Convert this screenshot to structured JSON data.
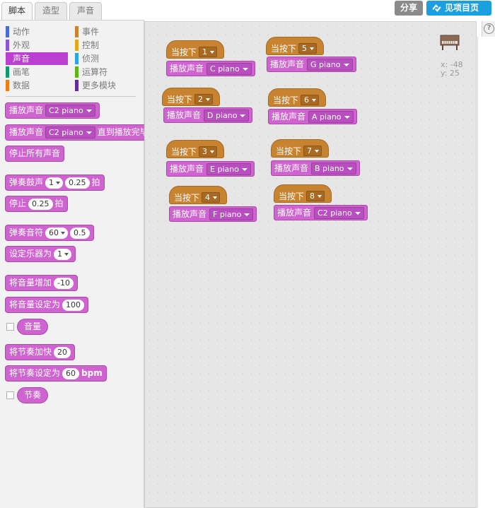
{
  "tabs": [
    {
      "label": "脚本",
      "active": true
    },
    {
      "label": "造型",
      "active": false
    },
    {
      "label": "声音",
      "active": false
    }
  ],
  "header": {
    "share_label": "分享",
    "project_page_label": "见项目页"
  },
  "categories": {
    "left": [
      {
        "label": "动作",
        "color": "#4a6cd4"
      },
      {
        "label": "外观",
        "color": "#8a55d7"
      },
      {
        "label": "声音",
        "color": "#bb3fd1",
        "selected": true
      },
      {
        "label": "画笔",
        "color": "#0e9a6c"
      },
      {
        "label": "数据",
        "color": "#ee7d16"
      }
    ],
    "right": [
      {
        "label": "事件",
        "color": "#c88330"
      },
      {
        "label": "控制",
        "color": "#e1a91a"
      },
      {
        "label": "侦测",
        "color": "#2ca5e2"
      },
      {
        "label": "运算符",
        "color": "#5cb712"
      },
      {
        "label": "更多模块",
        "color": "#632d99"
      }
    ]
  },
  "palette": {
    "play_sound": {
      "text": "播放声音",
      "sound": "C2 piano"
    },
    "play_sound_until_done": {
      "text": "播放声音",
      "sound": "C2 piano",
      "suffix": "直到播放完毕"
    },
    "stop_all_sounds": "停止所有声音",
    "play_drum": {
      "text": "弹奏鼓声",
      "drum": "1",
      "beats": "0.25",
      "unit": "拍"
    },
    "rest": {
      "text": "停止",
      "beats": "0.25",
      "unit": "拍"
    },
    "play_note": {
      "text": "弹奏音符",
      "note": "60",
      "beats": "0.5"
    },
    "set_instrument": {
      "text": "设定乐器为",
      "value": "1"
    },
    "change_volume": {
      "text": "将音量增加",
      "value": "-10"
    },
    "set_volume": {
      "text": "将音量设定为",
      "value": "100"
    },
    "volume_reporter": "音量",
    "change_tempo": {
      "text": "将节奏加快",
      "value": "20"
    },
    "set_tempo": {
      "text": "将节奏设定为",
      "value": "60",
      "unit": "bpm"
    },
    "tempo_reporter": "节奏"
  },
  "scripts": [
    {
      "hat": "当按下",
      "key": "1",
      "action": "播放声音",
      "sound": "C piano"
    },
    {
      "hat": "当按下",
      "key": "2",
      "action": "播放声音",
      "sound": "D piano"
    },
    {
      "hat": "当按下",
      "key": "3",
      "action": "播放声音",
      "sound": "E piano"
    },
    {
      "hat": "当按下",
      "key": "4",
      "action": "播放声音",
      "sound": "F piano"
    },
    {
      "hat": "当按下",
      "key": "5",
      "action": "播放声音",
      "sound": "G piano"
    },
    {
      "hat": "当按下",
      "key": "6",
      "action": "播放声音",
      "sound": "A piano"
    },
    {
      "hat": "当按下",
      "key": "7",
      "action": "播放声音",
      "sound": "B piano"
    },
    {
      "hat": "当按下",
      "key": "8",
      "action": "播放声音",
      "sound": "C2 piano"
    }
  ],
  "sprite_info": {
    "x_label": "x:",
    "x": "-48",
    "y_label": "y:",
    "y": "25"
  },
  "help_label": "?"
}
